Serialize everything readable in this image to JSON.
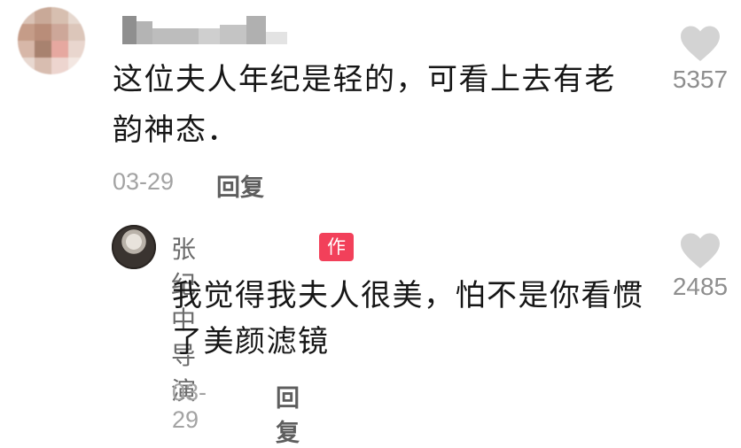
{
  "comment": {
    "text": "这位夫人年纪是轻的，可看上去有老韵神态．",
    "date": "03-29",
    "reply_label": "回复",
    "likes": "5357"
  },
  "reply": {
    "author": "张纪中导演",
    "badge": "作者",
    "text": "我觉得我夫人很美，怕不是你看惯了美颜滤镜",
    "date": "03-29",
    "reply_label": "回复",
    "likes": "2485"
  },
  "colors": {
    "badge": "#f2405a",
    "text": "#161616",
    "muted": "#a3a3a3",
    "heart": "#d3d3d3"
  },
  "icons": {
    "like": "heart-icon"
  }
}
